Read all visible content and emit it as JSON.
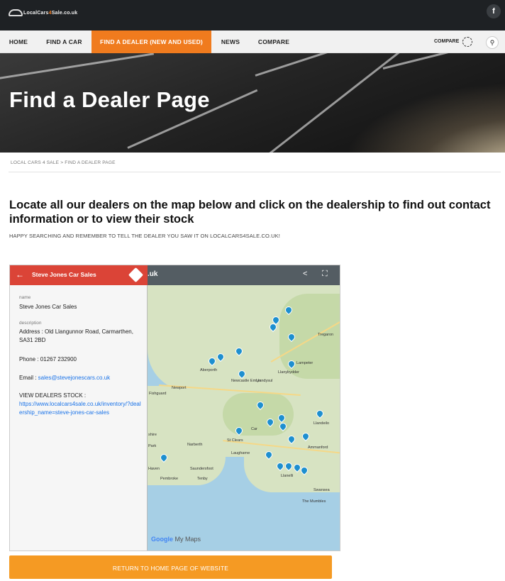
{
  "site": {
    "logo_text_a": "LocalCars",
    "logo_text_b": "4",
    "logo_text_c": "Sale.co.uk",
    "social_icon": "f"
  },
  "nav": {
    "items": [
      "HOME",
      "FIND A CAR",
      "FIND A DEALER (NEW AND USED)",
      "NEWS",
      "COMPARE"
    ],
    "active_index": 2,
    "compare_label": "COMPARE",
    "search_icon": "search-icon"
  },
  "hero": {
    "title": "Find a Dealer Page"
  },
  "breadcrumb": {
    "home": "LOCAL CARS 4 SALE",
    "sep": ">",
    "current": "FIND A DEALER PAGE"
  },
  "content": {
    "headline": "Locate all our dealers on the map below and click on the dealership to find out contact information or to view their stock",
    "subline": "HAPPY SEARCHING AND REMEMBER TO TELL THE DEALER YOU SAW IT ON LOCALCARS4SALE.CO.UK!"
  },
  "map": {
    "domain_fragment": ".uk",
    "panel_title": "Steve Jones Car Sales",
    "name_label": "name",
    "name_value": "Steve Jones Car Sales",
    "description_label": "description",
    "address": "Address : Old Llangunnor Road, Carmarthen, SA31 2BD",
    "phone": "Phone : 01267 232900",
    "email_prefix": "Email : ",
    "email": "sales@stevejonescars.co.uk",
    "stock_label": "VIEW DEALERS STOCK :",
    "stock_url": "https://www.localcars4sale.co.uk/inventory/?dealership_name=steve-jones-car-sales",
    "place_labels": [
      "Tregaron",
      "Lampeter",
      "Llanybydder",
      "Aberporth",
      "Newcastle Emlyn",
      "Llandysul",
      "Fishguard",
      "Newport",
      "Llandeilo",
      "St Clears",
      "Laugharne",
      "Ammanford",
      "Narberth",
      "Haven",
      "Pembroke",
      "Tenby",
      "Saundersfoot",
      "Llanelli",
      "Swansea",
      "The Mumbles",
      "Car",
      "shire",
      "Park"
    ],
    "attribution_a": "Google",
    "attribution_b": "My Maps",
    "accent_color": "#db4437",
    "pin_color": "#1e8fcf"
  },
  "cta": {
    "label": "RETURN TO HOME PAGE OF WEBSITE"
  },
  "colors": {
    "topbar": "#1e2124",
    "nav_active": "#f07b1e",
    "button": "#f59a23"
  }
}
